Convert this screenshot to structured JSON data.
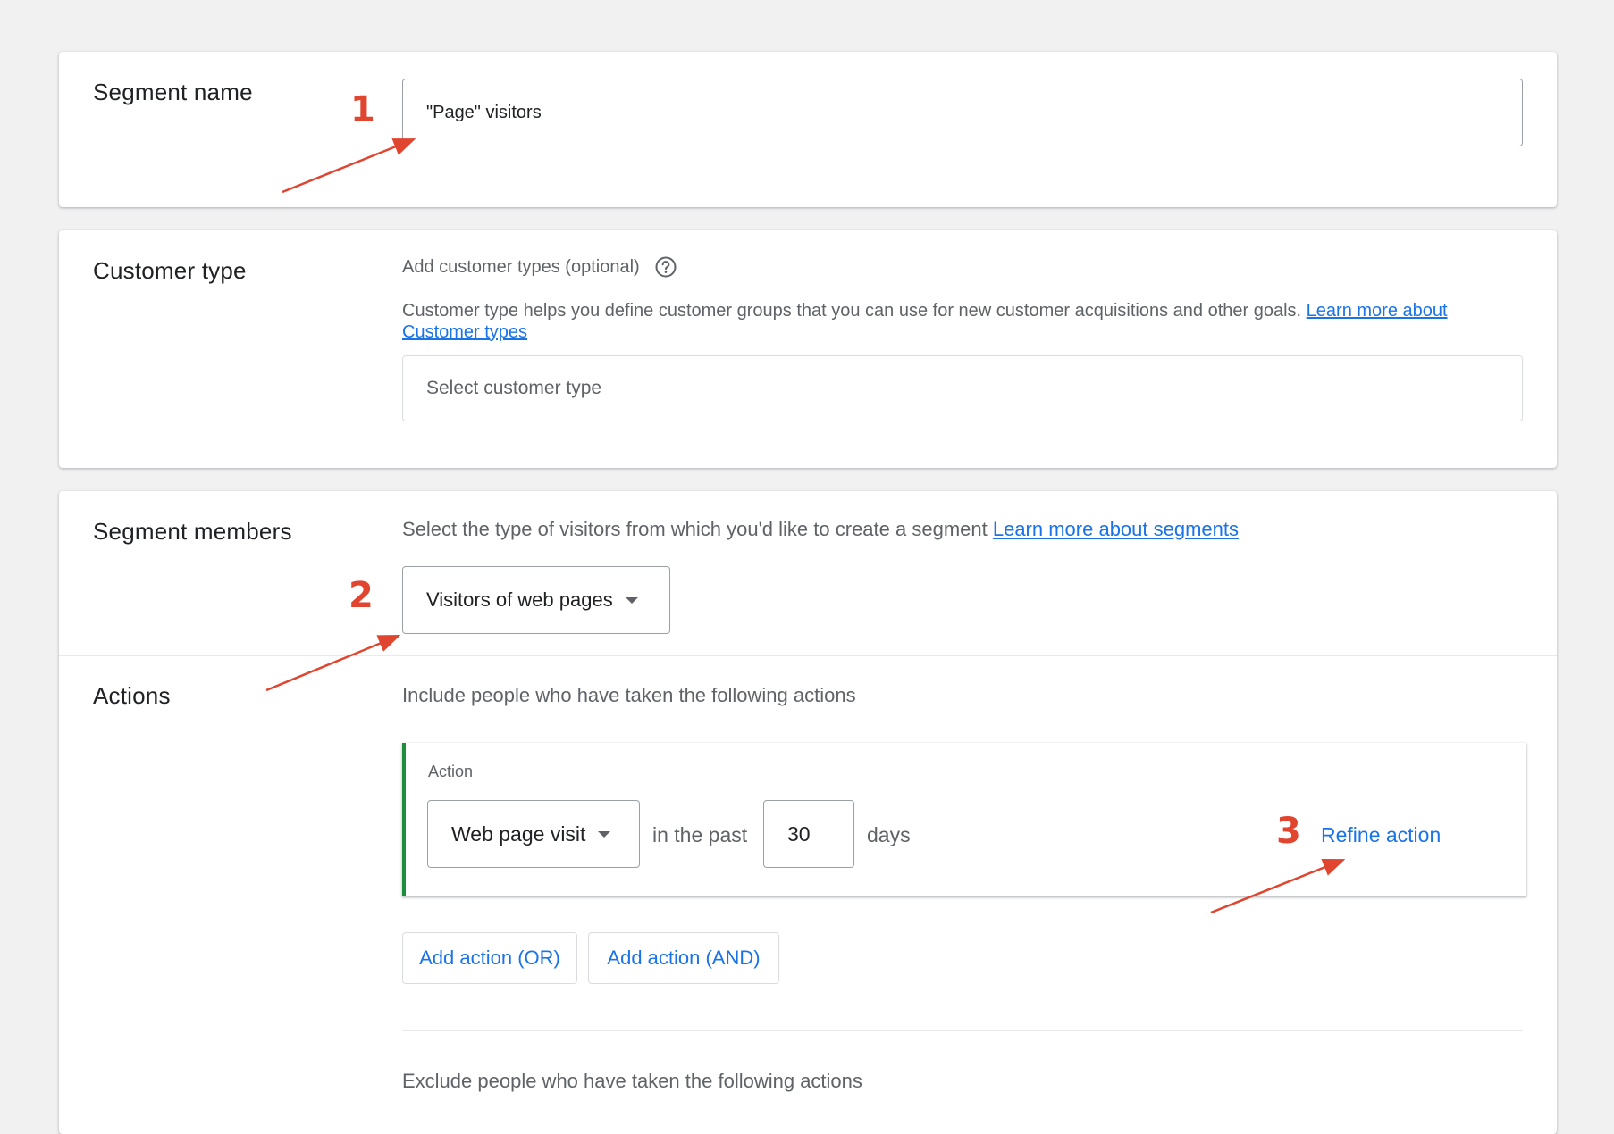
{
  "segment_name": {
    "title": "Segment name",
    "value": "\"Page\" visitors"
  },
  "customer_type": {
    "title": "Customer type",
    "label": "Add customer types (optional)",
    "help_icon": "help-circle-icon",
    "description": "Customer type helps you define customer groups that you can use for new customer acquisitions and other goals. ",
    "learn_more": "Learn more about Customer types",
    "select_placeholder": "Select customer type"
  },
  "segment_members": {
    "title": "Segment members",
    "description": "Select the type of visitors from which you'd like to create a segment ",
    "learn_more": "Learn more about segments",
    "dropdown_value": "Visitors of web pages"
  },
  "actions": {
    "title": "Actions",
    "include_text": "Include people who have taken the following actions",
    "action_label": "Action",
    "action_value": "Web page visit",
    "in_the_past": "in the past",
    "days_value": "30",
    "days_label": "days",
    "refine_action": "Refine action",
    "add_or": "Add action (OR)",
    "add_and": "Add action (AND)",
    "exclude_text": "Exclude people who have taken the following actions"
  },
  "annotations": {
    "step1": "1",
    "step2": "2",
    "step3": "3",
    "color": "#e0452f"
  },
  "colors": {
    "accent": "#1a73e8",
    "action_bar": "#1e8e3e"
  }
}
